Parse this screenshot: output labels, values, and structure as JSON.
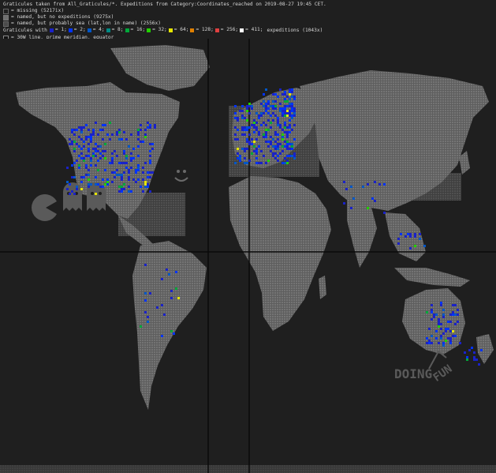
{
  "legend": {
    "title": "Graticules taken from All_Graticules/*. Expeditions from Category:Coordinates_reached on 2019-08-27 19:45 CET.",
    "missing": "= missing (5217ix)",
    "named_no_exp": "= named, but no expeditions (9275x)",
    "sea": "= named, but probably sea (lat,lon in name) (2556x)",
    "graticules_with": "Graticules with",
    "buckets": [
      {
        "label": "1",
        "color": "#1a22c8"
      },
      {
        "label": "2",
        "color": "#0033ff"
      },
      {
        "label": "4",
        "color": "#0057c8"
      },
      {
        "label": "8",
        "color": "#008a84"
      },
      {
        "label": "16",
        "color": "#00a83a"
      },
      {
        "label": "32",
        "color": "#22d000"
      },
      {
        "label": "64",
        "color": "#e6e600"
      },
      {
        "label": "128",
        "color": "#e08000"
      },
      {
        "label": "256",
        "color": "#e04040"
      },
      {
        "label": "411",
        "color": "#ffffff"
      }
    ],
    "expeditions_total": "expeditions (1043x)",
    "line_note": "= 30W line, prime meridian, equator"
  },
  "map": {
    "ocean_color": "#1f1f1f",
    "land_color": "#6a6a6a",
    "sea_named_color": "#4b4b4b",
    "line_color": "#0a0a0a",
    "label_doing": "DOING",
    "label_fun": "FUN"
  }
}
